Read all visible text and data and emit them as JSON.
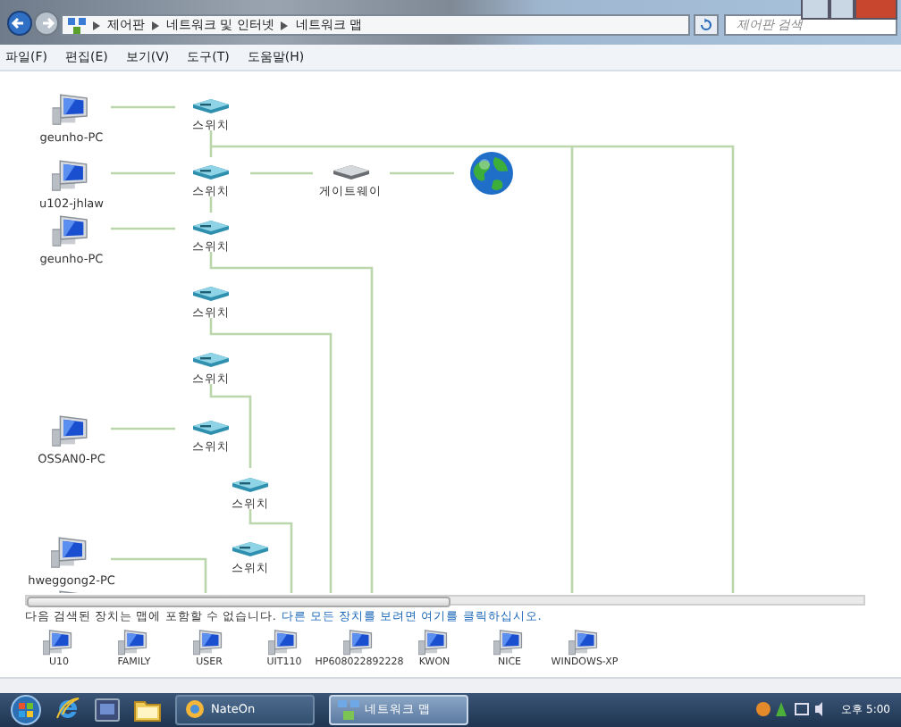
{
  "window": {
    "breadcrumb": [
      "제어판",
      "네트워크 및 인터넷",
      "네트워크 맵"
    ],
    "search": {
      "placeholder": "제어판 검색"
    }
  },
  "menu": [
    "파일(F)",
    "편집(E)",
    "보기(V)",
    "도구(T)",
    "도움말(H)"
  ],
  "map": {
    "nodes": [
      {
        "kind": "pc",
        "label": "geunho-PC"
      },
      {
        "kind": "switch",
        "label": "스위치"
      },
      {
        "kind": "pc",
        "label": "u102-jhlaw"
      },
      {
        "kind": "switch",
        "label": "스위치"
      },
      {
        "kind": "gateway",
        "label": "게이트웨이"
      },
      {
        "kind": "internet"
      },
      {
        "kind": "pc",
        "label": "geunho-PC"
      },
      {
        "kind": "switch",
        "label": "스위치"
      },
      {
        "kind": "switch",
        "label": "스위치"
      },
      {
        "kind": "switch",
        "label": "스위치"
      },
      {
        "kind": "pc",
        "label": "OSSAN0-PC"
      },
      {
        "kind": "switch",
        "label": "스위치"
      },
      {
        "kind": "switch",
        "label": "스위치"
      },
      {
        "kind": "pc",
        "label": "hweggong2-PC"
      },
      {
        "kind": "switch",
        "label": "스위치"
      },
      {
        "kind": "pc"
      }
    ]
  },
  "unmapped": {
    "notice": "다음 검색된 장치는 맵에 포함할 수 없습니다.",
    "link": "다른 모든 장치를 보려면 여기를 클릭하십시오.",
    "devices": [
      "U10",
      "FAMILY",
      "USER",
      "UIT110",
      "HP608022892228",
      "KWON",
      "NICE",
      "WINDOWS-XP"
    ]
  },
  "taskbar": {
    "buttons": [
      {
        "label": "NateOn",
        "selected": false
      },
      {
        "label": "네트워크 맵",
        "selected": true
      }
    ],
    "clock": "오후 5:00"
  }
}
